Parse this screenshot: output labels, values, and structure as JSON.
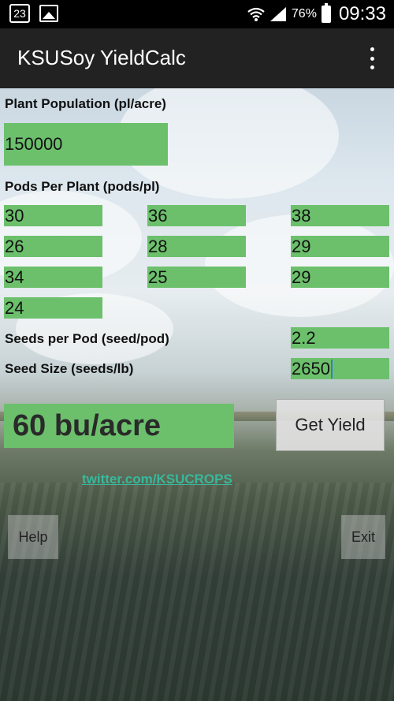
{
  "status_bar": {
    "temperature": "23",
    "battery_percent": "76%",
    "time": "09:33",
    "icons": [
      "temperature-badge-icon",
      "gallery-icon",
      "wifi-icon",
      "signal-icon",
      "battery-icon"
    ]
  },
  "action_bar": {
    "title": "KSUSoy YieldCalc",
    "menu_icon": "overflow-menu-icon"
  },
  "form": {
    "plant_population_label": "Plant Population (pl/acre)",
    "plant_population_value": "150000",
    "pods_per_plant_label": "Pods Per Plant (pods/pl)",
    "pods": [
      "30",
      "36",
      "38",
      "26",
      "28",
      "29",
      "34",
      "25",
      "29",
      "24"
    ],
    "seeds_per_pod_label": "Seeds per Pod (seed/pod)",
    "seeds_per_pod_value": "2.2",
    "seed_size_label": "Seed Size (seeds/lb)",
    "seed_size_value": "2650"
  },
  "result": {
    "yield_text": "60 bu/acre",
    "get_yield_label": "Get Yield"
  },
  "link_text": "twitter.com/KSUCROPS",
  "buttons": {
    "help_label": "Help",
    "exit_label": "Exit"
  },
  "colors": {
    "field_green": "#6cc06c",
    "link_teal": "#38b89c",
    "action_bar": "#222222"
  }
}
